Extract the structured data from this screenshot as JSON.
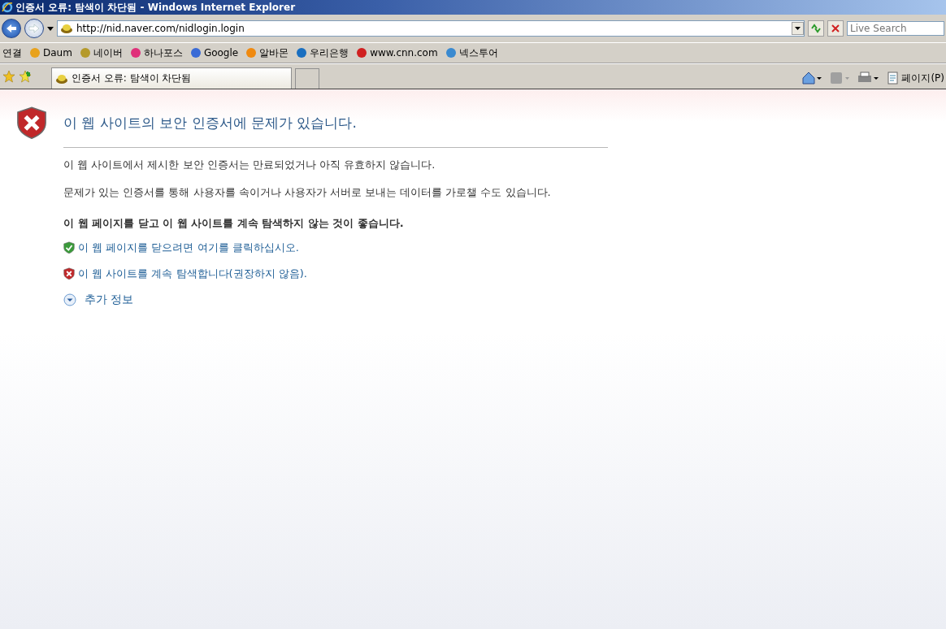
{
  "window": {
    "title": "인증서 오류: 탐색이 차단됨 - Windows Internet Explorer"
  },
  "address": {
    "value": "http://nid.naver.com/nidlogin.login"
  },
  "search": {
    "placeholder": "Live Search"
  },
  "links_bar": {
    "label": "연결",
    "items": [
      {
        "label": "Daum",
        "color": "#e8a21c"
      },
      {
        "label": "네이버",
        "color": "#b59a2a"
      },
      {
        "label": "하나포스",
        "color": "#e0307a"
      },
      {
        "label": "Google",
        "color": "#3a6bd6"
      },
      {
        "label": "알바몬",
        "color": "#f08a10"
      },
      {
        "label": "우리은행",
        "color": "#1a6fc0"
      },
      {
        "label": "www.cnn.com",
        "color": "#d02020"
      },
      {
        "label": "넥스투어",
        "color": "#3a8ad0"
      }
    ]
  },
  "tabs": [
    {
      "label": "인증서 오류: 탐색이 차단됨",
      "selected": true
    }
  ],
  "command_bar": {
    "page_menu": "페이지(P)"
  },
  "error_page": {
    "heading": "이 웹 사이트의 보안 인증서에 문제가 있습니다.",
    "paragraphs": [
      "이 웹 사이트에서 제시한 보안 인증서는 만료되었거나 아직 유효하지 않습니다.",
      "문제가 있는 인증서를 통해 사용자를 속이거나 사용자가 서버로 보내는 데이터를 가로챌 수도 있습니다."
    ],
    "recommendation": "이 웹 페이지를 닫고 이 웹 사이트를 계속 탐색하지 않는 것이 좋습니다.",
    "options": [
      {
        "kind": "safe",
        "label": "이 웹 페이지를 닫으려면 여기를 클릭하십시오."
      },
      {
        "kind": "unsafe",
        "label": "이 웹 사이트를 계속 탐색합니다(권장하지 않음)."
      }
    ],
    "more_info": {
      "label": "추가 정보",
      "expanded": false
    }
  }
}
